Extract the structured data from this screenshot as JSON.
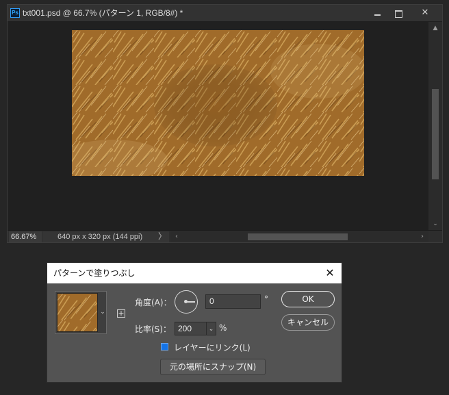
{
  "document": {
    "app_badge": "Ps",
    "title": "txt001.psd @ 66.7% (パターン 1, RGB/8#) *",
    "window_controls": {
      "close_glyph": "✕"
    },
    "status": {
      "zoom": "66.67%",
      "info": "640 px x 320 px (144 ppi)",
      "info_arrow": "〉"
    },
    "scroll_glyphs": {
      "up": "▲",
      "down": "⌄",
      "left": "‹",
      "right": "›"
    }
  },
  "dialog": {
    "title": "パターンで塗りつぶし",
    "close_glyph": "✕",
    "swatch_arrow": "⌄",
    "add_preset_glyph": "+",
    "angle": {
      "label": "角度(A)：",
      "value": "0",
      "unit": "°"
    },
    "scale": {
      "label": "比率(S)：",
      "value": "200",
      "chevron": "⌄",
      "unit": "%"
    },
    "link_layer": {
      "label": "レイヤーにリンク(L)",
      "checked": true
    },
    "ok_label": "OK",
    "cancel_label": "キャンセル",
    "snap_label": "元の場所にスナップ(N)"
  },
  "colors": {
    "accent": "#1473e6",
    "grass_base": "#a06b2a",
    "grass_light": "#d6aa5e"
  }
}
